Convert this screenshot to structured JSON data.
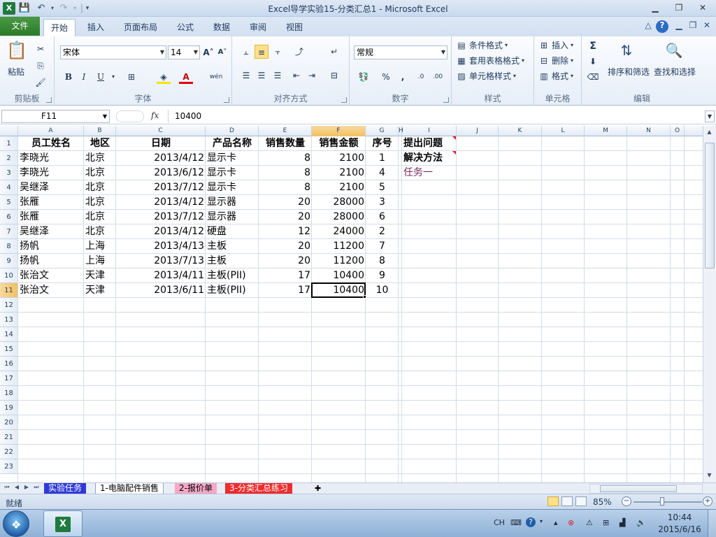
{
  "window": {
    "title": "Excel导学实验15-分类汇总1  -  Microsoft Excel",
    "logo_text": "X",
    "qat_separator": "|"
  },
  "ribbon_tabs": [
    "文件",
    "开始",
    "插入",
    "页面布局",
    "公式",
    "数据",
    "审阅",
    "视图"
  ],
  "ribbon": {
    "clipboard": {
      "label": "剪贴板",
      "paste": "粘贴"
    },
    "font": {
      "label": "字体",
      "name": "宋体",
      "size": "14",
      "phonetic": "wén"
    },
    "alignment": {
      "label": "对齐方式"
    },
    "number": {
      "label": "数字",
      "format": "常规"
    },
    "styles": {
      "label": "样式",
      "conditional": "条件格式",
      "table": "套用表格格式",
      "cell_styles": "单元格样式"
    },
    "cells": {
      "label": "单元格",
      "insert": "插入",
      "delete": "删除",
      "format": "格式"
    },
    "editing": {
      "label": "编辑",
      "sort_filter": "排序和筛选",
      "find_select": "查找和选择",
      "sum": "Σ"
    }
  },
  "formula_bar": {
    "name_box": "F11",
    "fx": "fx",
    "value": "10400"
  },
  "sheet": {
    "columns": [
      "A",
      "B",
      "C",
      "D",
      "E",
      "F",
      "G",
      "H",
      "I",
      "J",
      "K",
      "L",
      "M",
      "N",
      "O"
    ],
    "row_numbers": [
      "1",
      "2",
      "3",
      "4",
      "5",
      "6",
      "7",
      "8",
      "9",
      "10",
      "11",
      "12",
      "13",
      "14",
      "15",
      "16",
      "17",
      "18",
      "19",
      "20",
      "21",
      "22",
      "23"
    ],
    "headers": [
      "员工姓名",
      "地区",
      "日期",
      "产品名称",
      "销售数量",
      "销售金额",
      "序号"
    ],
    "rows": [
      [
        "李晓光",
        "北京",
        "2013/4/12",
        "显示卡",
        "8",
        "2100",
        "1"
      ],
      [
        "李晓光",
        "北京",
        "2013/6/12",
        "显示卡",
        "8",
        "2100",
        "4"
      ],
      [
        "吴继泽",
        "北京",
        "2013/7/12",
        "显示卡",
        "8",
        "2100",
        "5"
      ],
      [
        "张雁",
        "北京",
        "2013/4/12",
        "显示器",
        "20",
        "28000",
        "3"
      ],
      [
        "张雁",
        "北京",
        "2013/7/12",
        "显示器",
        "20",
        "28000",
        "6"
      ],
      [
        "吴继泽",
        "北京",
        "2013/4/12",
        "硬盘",
        "12",
        "24000",
        "2"
      ],
      [
        "扬帆",
        "上海",
        "2013/4/13",
        "主板",
        "20",
        "11200",
        "7"
      ],
      [
        "扬帆",
        "上海",
        "2013/7/13",
        "主板",
        "20",
        "11200",
        "8"
      ],
      [
        "张治文",
        "天津",
        "2013/4/11",
        "主板(PII)",
        "17",
        "10400",
        "9"
      ],
      [
        "张治文",
        "天津",
        "2013/6/11",
        "主板(PII)",
        "17",
        "10400",
        "10"
      ]
    ],
    "side_notes": [
      "提出问题",
      "解决方法",
      "任务一"
    ]
  },
  "sheet_tabs": [
    "实验任务",
    "1-电脑配件销售",
    "2-报价单",
    "3-分类汇总练习"
  ],
  "status": {
    "ready": "就绪",
    "zoom": "85%"
  },
  "taskbar": {
    "ime": "CH",
    "time": "10:44",
    "date": "2015/6/16"
  }
}
